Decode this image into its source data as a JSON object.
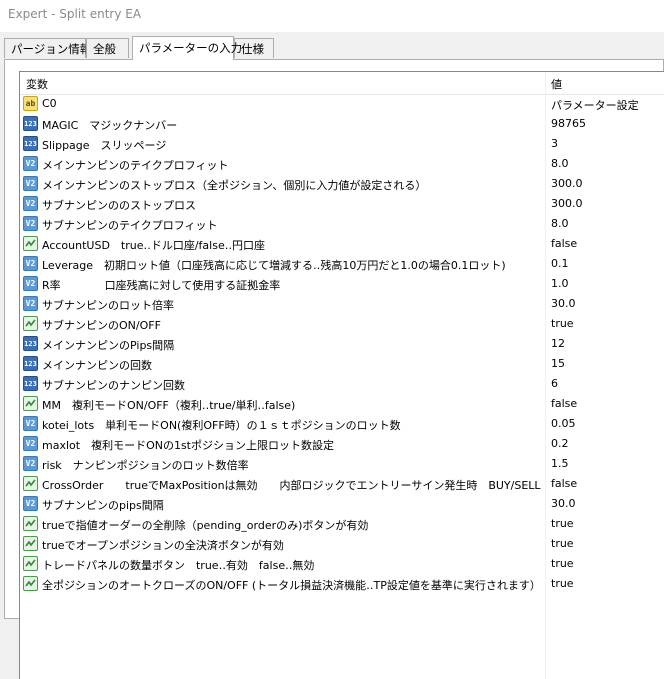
{
  "window": {
    "title": "Expert - Split entry EA"
  },
  "tabs": [
    {
      "label": "パージョン情報"
    },
    {
      "label": "全般"
    },
    {
      "label": "パラメーターの入力"
    },
    {
      "label": "仕様"
    }
  ],
  "table": {
    "col_name": "変数",
    "col_value": "値",
    "rows": [
      {
        "type": "ab",
        "name": "C0",
        "value": "パラメーター設定"
      },
      {
        "type": "123",
        "name": "MAGIC　マジックナンバー",
        "value": "98765"
      },
      {
        "type": "123",
        "name": "Slippage　スリッページ",
        "value": "3"
      },
      {
        "type": "V2",
        "name": "メインナンピンのテイクプロフィット",
        "value": "8.0"
      },
      {
        "type": "V2",
        "name": "メインナンピンのストップロス（全ポジション、個別に入力値が設定される）",
        "value": "300.0"
      },
      {
        "type": "V2",
        "name": "サブナンピンののストップロス",
        "value": "300.0"
      },
      {
        "type": "V2",
        "name": "サブナンピンのテイクプロフィット",
        "value": "8.0"
      },
      {
        "type": "bool",
        "name": "AccountUSD　true‥ドル口座/false‥円口座",
        "value": "false"
      },
      {
        "type": "V2",
        "name": "Leverage　初期ロット値（口座残高に応じて増減する‥残高10万円だと1.0の場合0.1ロット)",
        "value": "0.1"
      },
      {
        "type": "V2",
        "name": "R率　　　　口座残高に対して使用する証拠金率",
        "value": "1.0"
      },
      {
        "type": "V2",
        "name": "サブナンピンのロット倍率",
        "value": "30.0"
      },
      {
        "type": "bool",
        "name": "サブナンピンのON/OFF",
        "value": "true"
      },
      {
        "type": "123",
        "name": "メインナンピンのPips間隔",
        "value": "12"
      },
      {
        "type": "123",
        "name": "メインナンピンの回数",
        "value": "15"
      },
      {
        "type": "123",
        "name": "サブナンピンのナンピン回数",
        "value": "6"
      },
      {
        "type": "bool",
        "name": "MM　複利モードON/OFF（複利‥true/単利‥false)",
        "value": "false"
      },
      {
        "type": "V2",
        "name": "kotei_lots　単利モードON(複利OFF時）の１ｓｔポジションのロット数",
        "value": "0.05"
      },
      {
        "type": "V2",
        "name": "maxlot　複利モードONの1stポジション上限ロット数設定",
        "value": "0.2"
      },
      {
        "type": "V2",
        "name": "risk　ナンピンポジションのロット数倍率",
        "value": "1.5"
      },
      {
        "type": "bool",
        "name": "CrossOrder　　trueでMaxPositionは無効　　内部ロジックでエントリーサイン発生時　BUY/SELL",
        "value": "false"
      },
      {
        "type": "V2",
        "name": "サブナンピンのpips間隔",
        "value": "30.0"
      },
      {
        "type": "bool",
        "name": "trueで指値オーダーの全削除（pending_orderのみ)ボタンが有効",
        "value": "true"
      },
      {
        "type": "bool",
        "name": "trueでオープンポジションの全決済ボタンが有効",
        "value": "true"
      },
      {
        "type": "bool",
        "name": "トレードパネルの数量ボタン　true‥有効　false‥無効",
        "value": "true"
      },
      {
        "type": "bool",
        "name": "全ポジションのオートクローズのON/OFF (トータル損益決済機能‥TP設定値を基準に実行されます）",
        "value": "true"
      }
    ]
  }
}
